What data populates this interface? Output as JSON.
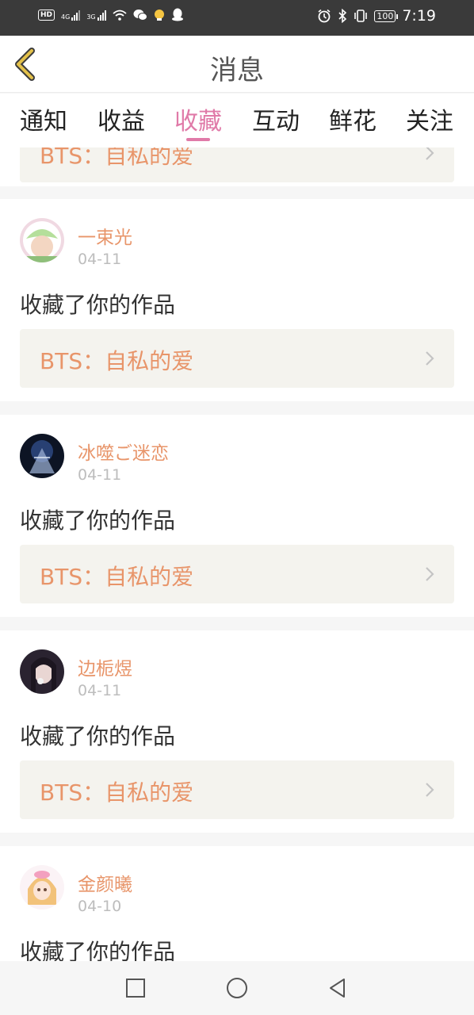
{
  "status_bar": {
    "hd_label": "HD",
    "sim1_label": "4G",
    "sim2_label": "3G",
    "battery": "100",
    "time": "7:19"
  },
  "header": {
    "title": "消息"
  },
  "tabs": [
    {
      "label": "通知",
      "active": false
    },
    {
      "label": "收益",
      "active": false
    },
    {
      "label": "收藏",
      "active": true
    },
    {
      "label": "互动",
      "active": false
    },
    {
      "label": "鲜花",
      "active": false
    },
    {
      "label": "关注",
      "active": false
    }
  ],
  "partial_card": {
    "work_title": "BTS：自私的爱"
  },
  "messages": [
    {
      "user": "一束光",
      "date": "04-11",
      "action": "收藏了你的作品",
      "work_title": "BTS：自私的爱"
    },
    {
      "user": "冰噬ご迷恋",
      "date": "04-11",
      "action": "收藏了你的作品",
      "work_title": "BTS：自私的爱"
    },
    {
      "user": "边栀煜",
      "date": "04-11",
      "action": "收藏了你的作品",
      "work_title": "BTS：自私的爱"
    },
    {
      "user": "金颜曦",
      "date": "04-10",
      "action": "收藏了你的作品",
      "work_title": ""
    }
  ],
  "icons": {
    "back": "chevron-left-icon",
    "row_arrow": "chevron-right-icon",
    "nav_recents": "square-icon",
    "nav_home": "circle-icon",
    "nav_back": "triangle-left-icon"
  },
  "colors": {
    "accent": "#e07aa8",
    "username": "#e8956a",
    "work_bg": "#f4f3ee",
    "back_icon": "#c9a23a"
  }
}
